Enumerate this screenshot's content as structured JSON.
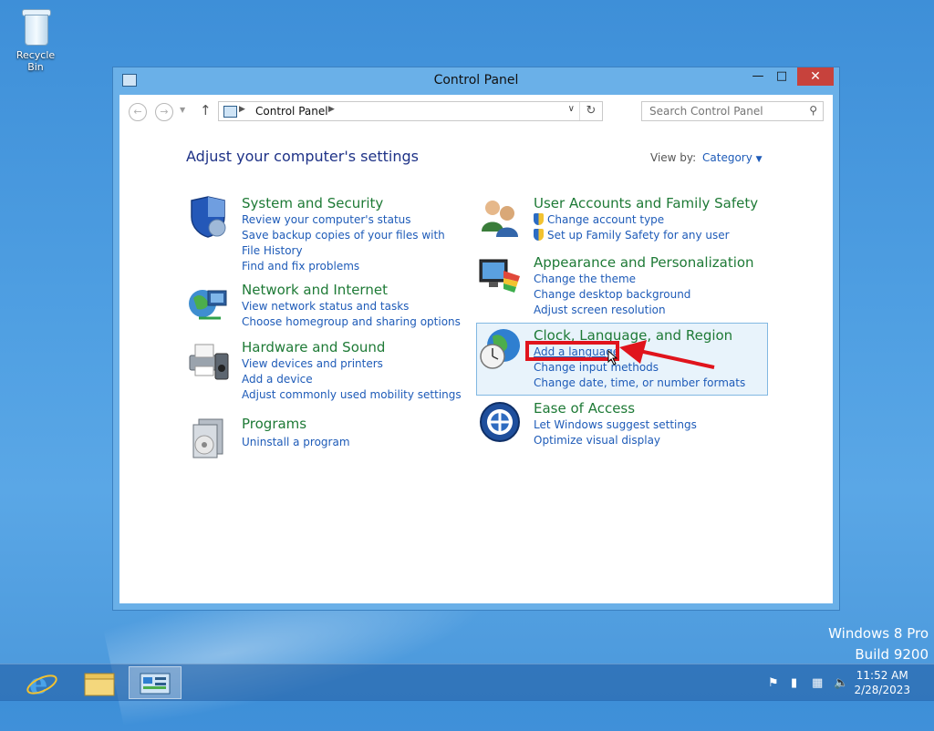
{
  "desktop": {
    "recycle_bin_label": "Recycle Bin",
    "watermark_line1": "Windows 8 Pro",
    "watermark_line2": "Build 9200"
  },
  "window": {
    "title": "Control Panel",
    "minimize_glyph": "—",
    "maximize_glyph": "□",
    "close_glyph": "✕"
  },
  "navbar": {
    "breadcrumb": "Control Panel",
    "search_placeholder": "Search Control Panel"
  },
  "main": {
    "heading": "Adjust your computer's settings",
    "view_by_label": "View by:",
    "view_by_value": "Category"
  },
  "categories_left": [
    {
      "title": "System and Security",
      "icon": "shield-icon",
      "links": [
        "Review your computer's status",
        "Save backup copies of your files with File History",
        "Find and fix problems"
      ]
    },
    {
      "title": "Network and Internet",
      "icon": "network-icon",
      "links": [
        "View network status and tasks",
        "Choose homegroup and sharing options"
      ]
    },
    {
      "title": "Hardware and Sound",
      "icon": "printer-icon",
      "links": [
        "View devices and printers",
        "Add a device",
        "Adjust commonly used mobility settings"
      ]
    },
    {
      "title": "Programs",
      "icon": "programs-icon",
      "links": [
        "Uninstall a program"
      ]
    }
  ],
  "categories_right": [
    {
      "title": "User Accounts and Family Safety",
      "icon": "users-icon",
      "links": [
        "Change account type",
        "Set up Family Safety for any user"
      ]
    },
    {
      "title": "Appearance and Personalization",
      "icon": "appearance-icon",
      "links": [
        "Change the theme",
        "Change desktop background",
        "Adjust screen resolution"
      ]
    },
    {
      "title": "Clock, Language, and Region",
      "icon": "globe-clock-icon",
      "links": [
        "Add a language",
        "Change input methods",
        "Change date, time, or number formats"
      ]
    },
    {
      "title": "Ease of Access",
      "icon": "ease-of-access-icon",
      "links": [
        "Let Windows suggest settings",
        "Optimize visual display"
      ]
    }
  ],
  "taskbar": {
    "time": "11:52 AM",
    "date": "2/28/2023"
  },
  "colors": {
    "category_title": "#1e7a36",
    "link": "#1e5bb8",
    "heading": "#1e3287",
    "callout": "#e0141c"
  }
}
